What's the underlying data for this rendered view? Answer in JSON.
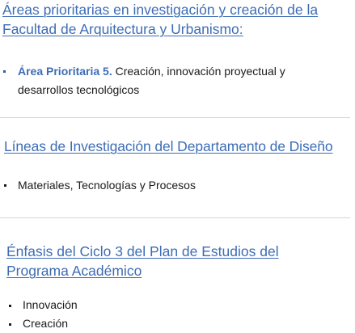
{
  "section1": {
    "heading_line1": "Áreas prioritarias en investigación y creación de la",
    "heading_line2": "Facultad de Arquitectura y Urbanismo:",
    "items": [
      {
        "label": "Área Prioritaria 5.",
        "text": "Creación, innovación proyectual y desarrollos tecnológicos"
      }
    ]
  },
  "section2": {
    "heading": "Líneas de Investigación del Departamento de Diseño",
    "items": [
      "Materiales, Tecnologías y Procesos"
    ]
  },
  "section3": {
    "heading_line1": "Énfasis del Ciclo 3 del Plan de Estudios del",
    "heading_line2": "Programa Académico",
    "items": [
      "Innovación",
      "Creación"
    ]
  },
  "colors": {
    "heading": "#3d6db5",
    "divider": "#c5dbe9",
    "body_text": "#1a1a1a"
  }
}
